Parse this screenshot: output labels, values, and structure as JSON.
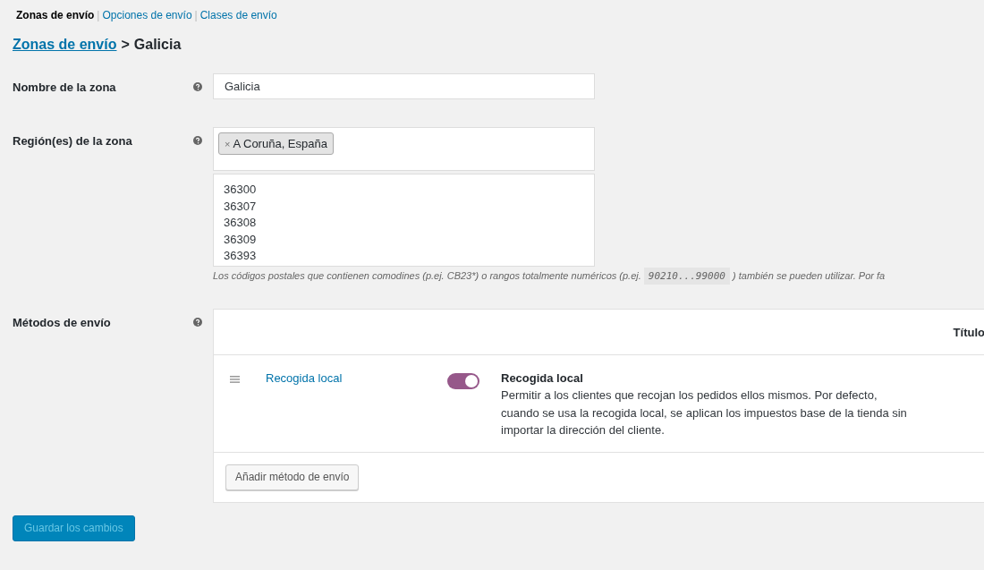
{
  "subnav": [
    {
      "label": "Zonas de envío",
      "selected": true
    },
    {
      "separator": "|",
      "label": "Opciones de envío",
      "selected": false
    },
    {
      "separator": "|",
      "label": "Clases de envío",
      "selected": false
    }
  ],
  "breadcrumb": {
    "link": "Zonas de envío",
    "separator": ">",
    "current": "Galicia"
  },
  "zone_name": {
    "label": "Nombre de la zona",
    "value": "Galicia"
  },
  "zone_regions": {
    "label": "Región(es) de la zona",
    "tags": [
      {
        "remove": "×",
        "label": "A Coruña, España"
      }
    ],
    "postcodes": [
      "36300",
      "36307",
      "36308",
      "36309",
      "36393"
    ],
    "hint_before": "Los códigos postales que contienen comodines (p.ej. CB23*) o rangos totalmente numéricos (p.ej.",
    "hint_code": "90210...99000",
    "hint_after": ") también se pueden utilizar. Por fa"
  },
  "methods": {
    "label": "Métodos de envío",
    "column_title": "Título",
    "rows": [
      {
        "title": "Recogida local",
        "on": true,
        "name": "Recogida local",
        "description": "Permitir a los clientes que recojan los pedidos ellos mismos. Por defecto, cuando se usa la recogida local, se aplican los impuestos base de la tienda sin importar la dirección del cliente."
      }
    ],
    "add_button": "Añadir método de envío"
  },
  "save_button": {
    "label": "Guardar los cambios",
    "disabled": true
  }
}
